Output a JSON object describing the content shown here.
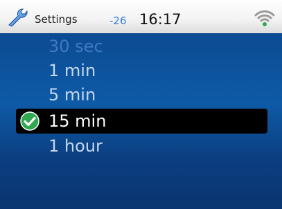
{
  "statusbar": {
    "app_icon": "wrench-icon",
    "title": "Settings",
    "signal_value": "-26",
    "time": "16:17",
    "wifi_icon": "wifi-icon"
  },
  "timeout_list": {
    "items": [
      {
        "label": "30 sec",
        "state": "faded"
      },
      {
        "label": "1 min",
        "state": "normal"
      },
      {
        "label": "5 min",
        "state": "normal"
      },
      {
        "label": "15 min",
        "state": "selected"
      },
      {
        "label": "1 hour",
        "state": "normal"
      }
    ],
    "selected_icon": "check-circle-icon"
  },
  "colors": {
    "background": "#0e5aa6",
    "selection_bar": "#000000",
    "selected_check": "#2fa84f",
    "signal_text": "#3b7ed8"
  }
}
